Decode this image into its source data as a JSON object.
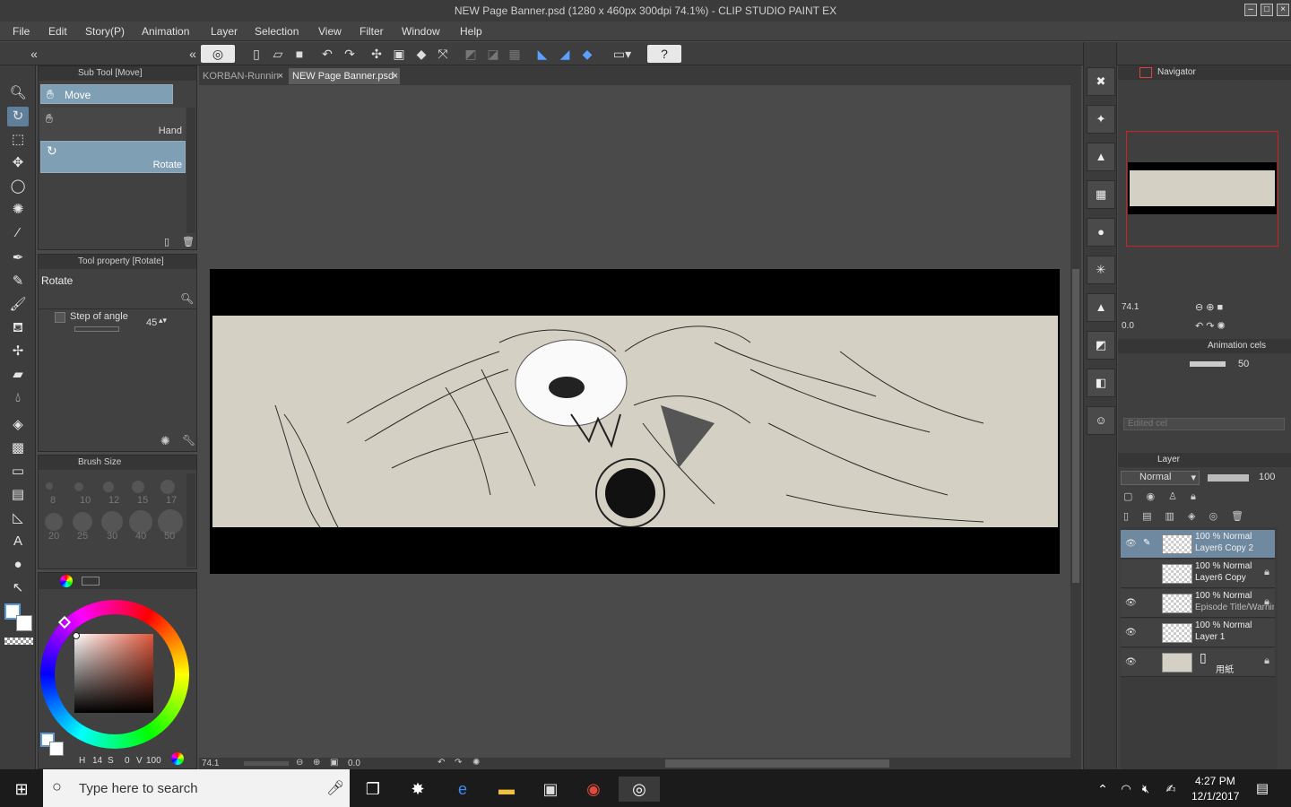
{
  "window": {
    "title": "NEW Page Banner.psd (1280 x 460px 300dpi 74.1%)  - CLIP STUDIO PAINT EX"
  },
  "menu": [
    "File",
    "Edit",
    "Story(P)",
    "Animation",
    "Layer",
    "Selection",
    "View",
    "Filter",
    "Window",
    "Help"
  ],
  "sub_tool": {
    "header": "Sub Tool [Move]",
    "items": [
      "Move",
      "Hand",
      "Rotate"
    ]
  },
  "tool_property": {
    "header": "Tool property [Rotate]",
    "name": "Rotate",
    "step_of_angle_label": "Step of angle",
    "step_of_angle_value": "45"
  },
  "brush_size": {
    "header": "Brush Size",
    "sizes": [
      "8",
      "10",
      "12",
      "15",
      "17",
      "20",
      "25",
      "30",
      "40",
      "50"
    ]
  },
  "color": {
    "h_label": "H",
    "h_value": "14",
    "s_label": "S",
    "s_value": "0",
    "v_label": "V",
    "v_value": "100",
    "hue_ring_color": "#e0563a"
  },
  "tabs": [
    {
      "label": "KORBAN-Runnin",
      "active": false
    },
    {
      "label": "NEW Page Banner.psd",
      "active": true
    }
  ],
  "statusbar": {
    "zoom": "74.1",
    "angle": "0.0"
  },
  "navigator": {
    "header": "Navigator",
    "zoom": "74.1",
    "angle": "0.0"
  },
  "animation_cels": {
    "header": "Animation cels",
    "value": "50",
    "edited_cel_placeholder": "Edited cel"
  },
  "layer_panel": {
    "header": "Layer",
    "blend_mode": "Normal",
    "opacity": "100",
    "layers": [
      {
        "mode": "100 % Normal",
        "name": "Layer6 Copy 2",
        "visible": true,
        "locked": false,
        "selected": true
      },
      {
        "mode": "100 % Normal",
        "name": "Layer6 Copy",
        "visible": false,
        "locked": true,
        "selected": false
      },
      {
        "mode": "100 % Normal",
        "name": "Episode Title/Warning",
        "visible": true,
        "locked": true,
        "selected": false
      },
      {
        "mode": "100 % Normal",
        "name": "Layer 1",
        "visible": true,
        "locked": false,
        "selected": false
      },
      {
        "mode": "",
        "name": "用紙",
        "visible": true,
        "locked": true,
        "selected": false
      }
    ]
  },
  "taskbar": {
    "search_placeholder": "Type here to search",
    "time": "4:27 PM",
    "date": "12/1/2017"
  }
}
